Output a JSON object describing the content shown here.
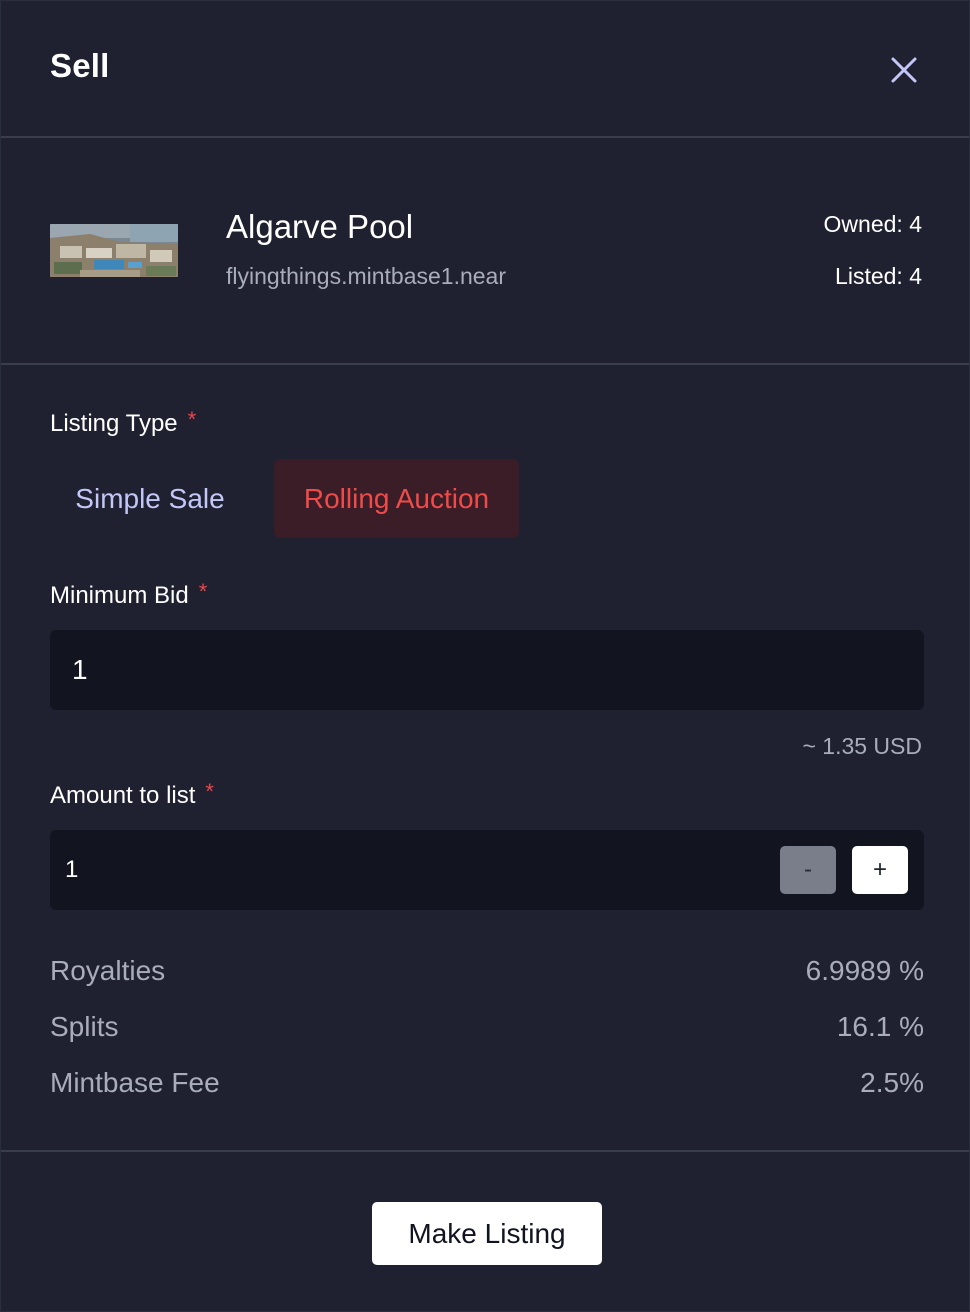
{
  "header": {
    "title": "Sell",
    "close_icon": "close-icon"
  },
  "token": {
    "name": "Algarve Pool",
    "contract": "flyingthings.mintbase1.near",
    "owned": "Owned: 4",
    "listed": "Listed: 4"
  },
  "listing_type": {
    "label": "Listing Type",
    "required_mark": "*",
    "options": [
      "Simple Sale",
      "Rolling Auction"
    ],
    "selected": "Rolling Auction"
  },
  "minimum_bid": {
    "label": "Minimum Bid",
    "required_mark": "*",
    "value": "1",
    "usd_estimate": "~ 1.35 USD"
  },
  "amount_to_list": {
    "label": "Amount to list",
    "required_mark": "*",
    "value": "1",
    "decrement_label": "-",
    "increment_label": "+"
  },
  "fees": [
    {
      "label": "Royalties",
      "value": "6.9989 %"
    },
    {
      "label": "Splits",
      "value": "16.1 %"
    },
    {
      "label": "Mintbase Fee",
      "value": "2.5%"
    }
  ],
  "footer": {
    "submit_label": "Make Listing"
  },
  "colors": {
    "background": "#1f2130",
    "input_background": "#121420",
    "accent_red": "#ef4b4b",
    "accent_lavender": "#c3c6f7",
    "muted_text": "#a9acbb"
  }
}
